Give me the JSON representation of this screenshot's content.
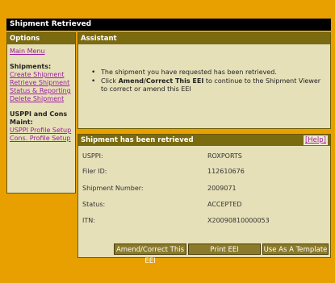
{
  "window": {
    "title": "Shipment Retrieved"
  },
  "sidebar": {
    "title": "Options",
    "main_menu": "Main Menu",
    "shipments_head": "Shipments:",
    "links": [
      "Create Shipment",
      "Retrieve Shipment",
      "Status & Reporting",
      "Delete Shipment"
    ],
    "usppi_head": "USPPI and Cons Maint:",
    "maint_links": [
      "USPPI Profile Setup",
      "Cons. Profile Setup"
    ]
  },
  "assistant": {
    "title": "Assistant",
    "line1": "The shipment you have requested has been retrieved.",
    "line2_pre": "Click ",
    "line2_bold": "Amend/Correct This EEI",
    "line2_post": " to continue to the Shipment Viewer to correct or amend this EEI"
  },
  "shipment": {
    "title": "Shipment has been retrieved",
    "help": "Help",
    "fields": [
      {
        "label": "USPPI:",
        "value": "ROXPORTS"
      },
      {
        "label": "Filer ID:",
        "value": "112610676"
      },
      {
        "label": "Shipment Number:",
        "value": "2009071"
      },
      {
        "label": "Status:",
        "value": "ACCEPTED"
      },
      {
        "label": "ITN:",
        "value": "X20090810000053"
      }
    ],
    "buttons": {
      "amend": "Amend/Correct This EEI",
      "print": "Print EEI",
      "template": "Use As A Template"
    }
  }
}
